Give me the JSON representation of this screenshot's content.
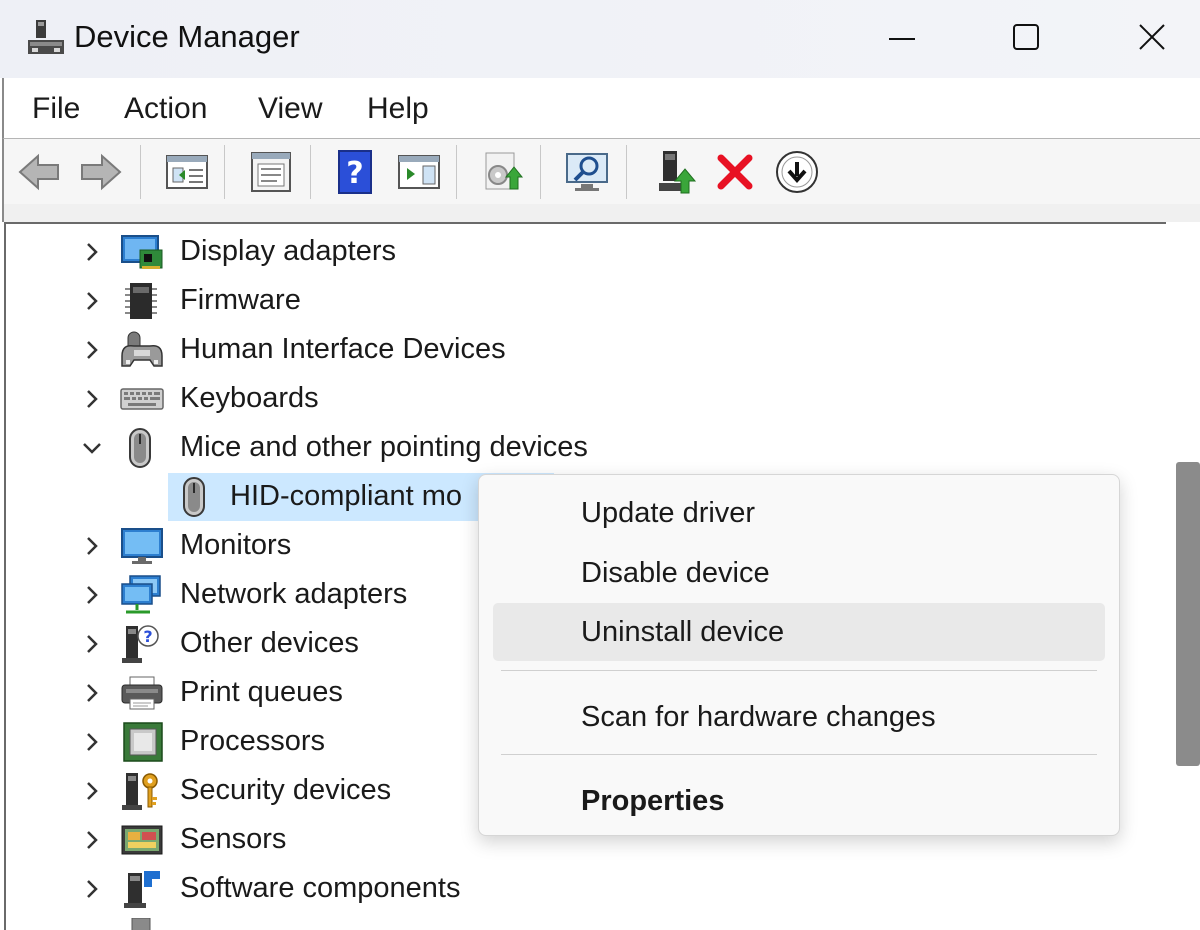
{
  "window": {
    "title": "Device Manager",
    "controls": {
      "minimize": "minimize-icon",
      "maximize": "maximize-icon",
      "close": "close-icon"
    }
  },
  "menu": {
    "file": "File",
    "action": "Action",
    "view": "View",
    "help": "Help"
  },
  "toolbar": {
    "buttons": [
      "back-arrow-icon",
      "forward-arrow-icon",
      "show-hide-console-tree-icon",
      "properties-icon",
      "help-icon",
      "show-action-pane-icon",
      "update-driver-icon",
      "scan-hardware-icon",
      "enable-device-icon",
      "uninstall-icon",
      "disable-device-icon"
    ]
  },
  "tree": {
    "items": [
      {
        "label": "Display adapters",
        "icon": "display-adapter-icon",
        "expanded": false
      },
      {
        "label": "Firmware",
        "icon": "firmware-chip-icon",
        "expanded": false
      },
      {
        "label": "Human Interface Devices",
        "icon": "hid-icon",
        "expanded": false
      },
      {
        "label": "Keyboards",
        "icon": "keyboard-icon",
        "expanded": false
      },
      {
        "label": "Mice and other pointing devices",
        "icon": "mouse-icon",
        "expanded": true
      },
      {
        "label": "Monitors",
        "icon": "monitor-icon",
        "expanded": false
      },
      {
        "label": "Network adapters",
        "icon": "network-adapter-icon",
        "expanded": false
      },
      {
        "label": "Other devices",
        "icon": "unknown-device-icon",
        "expanded": false
      },
      {
        "label": "Print queues",
        "icon": "printer-icon",
        "expanded": false
      },
      {
        "label": "Processors",
        "icon": "processor-icon",
        "expanded": false
      },
      {
        "label": "Security devices",
        "icon": "security-key-icon",
        "expanded": false
      },
      {
        "label": "Sensors",
        "icon": "sensor-icon",
        "expanded": false
      },
      {
        "label": "Software components",
        "icon": "software-component-icon",
        "expanded": false
      }
    ],
    "selected_child": {
      "label": "HID-compliant mo",
      "icon": "mouse-icon"
    }
  },
  "context_menu": {
    "update_driver": "Update driver",
    "disable_device": "Disable device",
    "uninstall_device": "Uninstall device",
    "scan_hardware": "Scan for hardware changes",
    "properties": "Properties",
    "highlighted": "Uninstall device"
  },
  "colors": {
    "selection": "#cce8ff",
    "menu_hover": "#e9e9e9",
    "delete_red": "#e81123",
    "help_blue": "#2b4fd8"
  }
}
